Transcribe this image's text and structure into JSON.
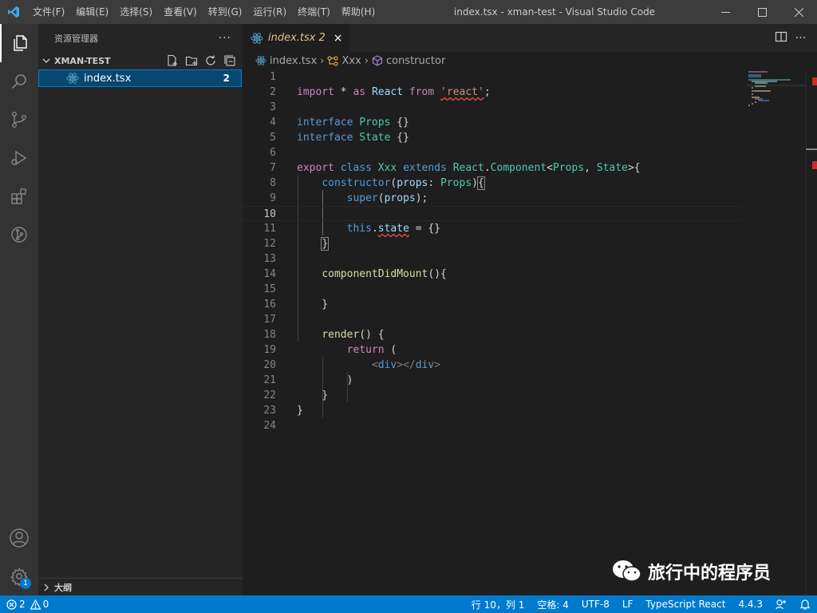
{
  "titlebar": {
    "menu": [
      "文件(F)",
      "编辑(E)",
      "选择(S)",
      "查看(V)",
      "转到(G)",
      "运行(R)",
      "终端(T)",
      "帮助(H)"
    ],
    "title": "index.tsx - xman-test - Visual Studio Code"
  },
  "activitybar": {
    "items": [
      "explorer-icon",
      "search-icon",
      "source-control-icon",
      "run-debug-icon",
      "extensions-icon",
      "git-graph-icon"
    ],
    "bottom": [
      "account-icon",
      "settings-gear-icon"
    ],
    "settings_badge": "1"
  },
  "sidebar": {
    "header": "资源管理器",
    "more": "···",
    "folder": "XMAN-TEST",
    "file": {
      "name": "index.tsx",
      "problems": "2"
    },
    "outline": "大纲"
  },
  "tab": {
    "name": "index.tsx",
    "problems": "2",
    "close": "×"
  },
  "breadcrumb": {
    "file": "index.tsx",
    "class": "Xxx",
    "member": "constructor"
  },
  "editor": {
    "current_line": 10
  },
  "statusbar": {
    "errors": "2",
    "warnings": "0",
    "position": "行 10，列 1",
    "indent": "空格: 4",
    "encoding": "UTF-8",
    "eol": "LF",
    "language": "TypeScript React",
    "version": "4.4.3"
  },
  "watermark": "旅行中的程序员",
  "colors": {
    "accent": "#007acc",
    "titlebar": "#3c3c3c",
    "sidebar": "#252526",
    "editor": "#1e1e1e",
    "modified_tab": "#e2c08d"
  }
}
